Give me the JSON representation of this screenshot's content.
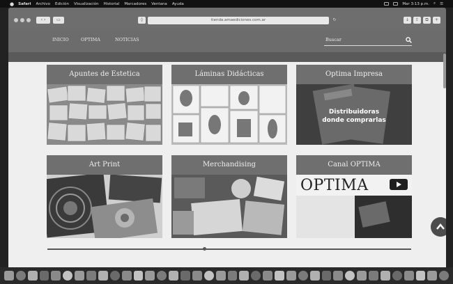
{
  "menubar": {
    "apple": "",
    "items": [
      "Safari",
      "Archivo",
      "Edición",
      "Visualización",
      "Historial",
      "Marcadores",
      "Ventana",
      "Ayuda"
    ],
    "clock": "Mar 3:13 p.m."
  },
  "browser": {
    "url": "tienda.amaediciones.com.ar"
  },
  "site": {
    "nav": [
      {
        "label": "INICIO"
      },
      {
        "label": "OPTIMA"
      },
      {
        "label": "NOTICIAS"
      }
    ],
    "search": {
      "placeholder": "Buscar"
    },
    "tiles": [
      {
        "title": "Apuntes de Estetica"
      },
      {
        "title": "Láminas Didácticas"
      },
      {
        "title": "Optima Impresa",
        "overlay": [
          "Distribuidoras",
          "donde comprarlas"
        ]
      },
      {
        "title": "Art Print"
      },
      {
        "title": "Merchandising"
      },
      {
        "title": "Canal OPTIMA",
        "logo_text": "OPTIMA"
      }
    ]
  },
  "dock": {
    "icon_count": 38
  }
}
